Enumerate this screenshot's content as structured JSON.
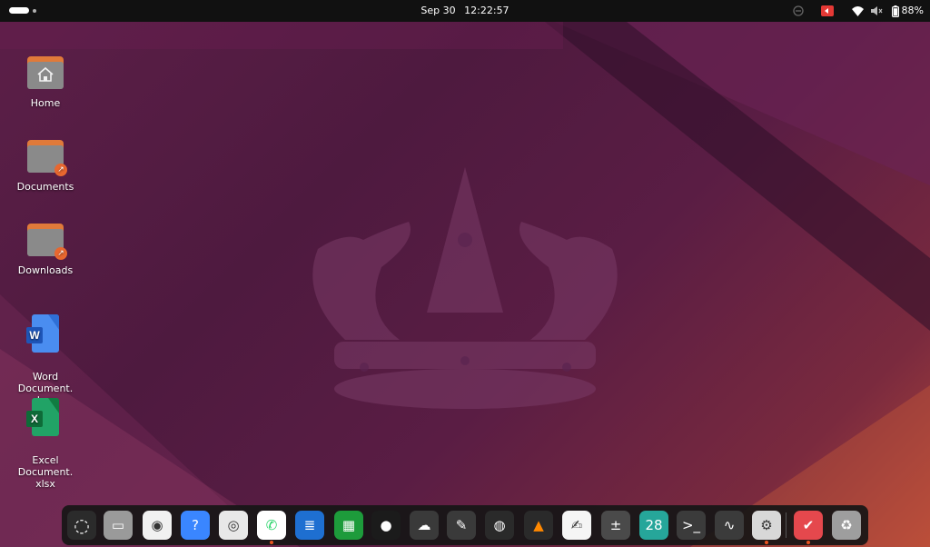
{
  "topbar": {
    "date": "Sep 30",
    "time": "12:22:57",
    "battery_percent": "88%",
    "tray_icons": [
      "night-light-icon",
      "screen-recording-icon",
      "wifi-icon",
      "volume-muted-icon",
      "battery-icon"
    ]
  },
  "desktop": {
    "icons": [
      {
        "label": "Home",
        "icon": "home-folder-icon"
      },
      {
        "label": "Documents",
        "icon": "folder-link-icon"
      },
      {
        "label": "Downloads",
        "icon": "folder-link-icon"
      },
      {
        "label": "Word Document.\ndocx",
        "icon": "word-document-icon"
      },
      {
        "label": "Excel Document.\nxlsx",
        "icon": "excel-document-icon"
      }
    ]
  },
  "dock": {
    "apps": [
      {
        "name": "show-apps",
        "glyph": "◌",
        "color": "#2b2b2b"
      },
      {
        "name": "files",
        "glyph": "▭",
        "color": "#9a9a9a"
      },
      {
        "name": "rhythmbox",
        "glyph": "◉",
        "color": "#f1f1f1"
      },
      {
        "name": "help",
        "glyph": "?",
        "color": "#3a86ff"
      },
      {
        "name": "chrome",
        "glyph": "◎",
        "color": "#e8e8e8"
      },
      {
        "name": "whatsapp",
        "glyph": "✆",
        "color": "#ffffff",
        "running": true
      },
      {
        "name": "libreoffice-writer",
        "glyph": "≣",
        "color": "#1e6fd1"
      },
      {
        "name": "libreoffice-calc",
        "glyph": "▦",
        "color": "#1d9b3b"
      },
      {
        "name": "camera",
        "glyph": "●",
        "color": "#1b1b1b"
      },
      {
        "name": "cloud",
        "glyph": "☁",
        "color": "#3a3a3a"
      },
      {
        "name": "gimp",
        "glyph": "✎",
        "color": "#3a3a3a"
      },
      {
        "name": "obs-studio",
        "glyph": "◍",
        "color": "#2a2a2a"
      },
      {
        "name": "vlc",
        "glyph": "▲",
        "color": "#2a2a2a"
      },
      {
        "name": "text-editor",
        "glyph": "✍",
        "color": "#f5f5f5"
      },
      {
        "name": "calculator",
        "glyph": "±",
        "color": "#4a4a4a"
      },
      {
        "name": "calendar",
        "glyph": "28",
        "color": "#26a69a"
      },
      {
        "name": "terminal",
        "glyph": ">_",
        "color": "#3b3b3b"
      },
      {
        "name": "system-monitor",
        "glyph": "∿",
        "color": "#3b3b3b"
      },
      {
        "name": "settings",
        "glyph": "⚙",
        "color": "#d8d8d8",
        "running": true
      },
      {
        "name": "todo",
        "glyph": "✔",
        "color": "#e5484d",
        "running": true
      },
      {
        "name": "trash",
        "glyph": "♻",
        "color": "#9e9e9e"
      }
    ]
  },
  "colors": {
    "accent": "#e95420",
    "topbar": "#111111",
    "dock": "#161616"
  }
}
